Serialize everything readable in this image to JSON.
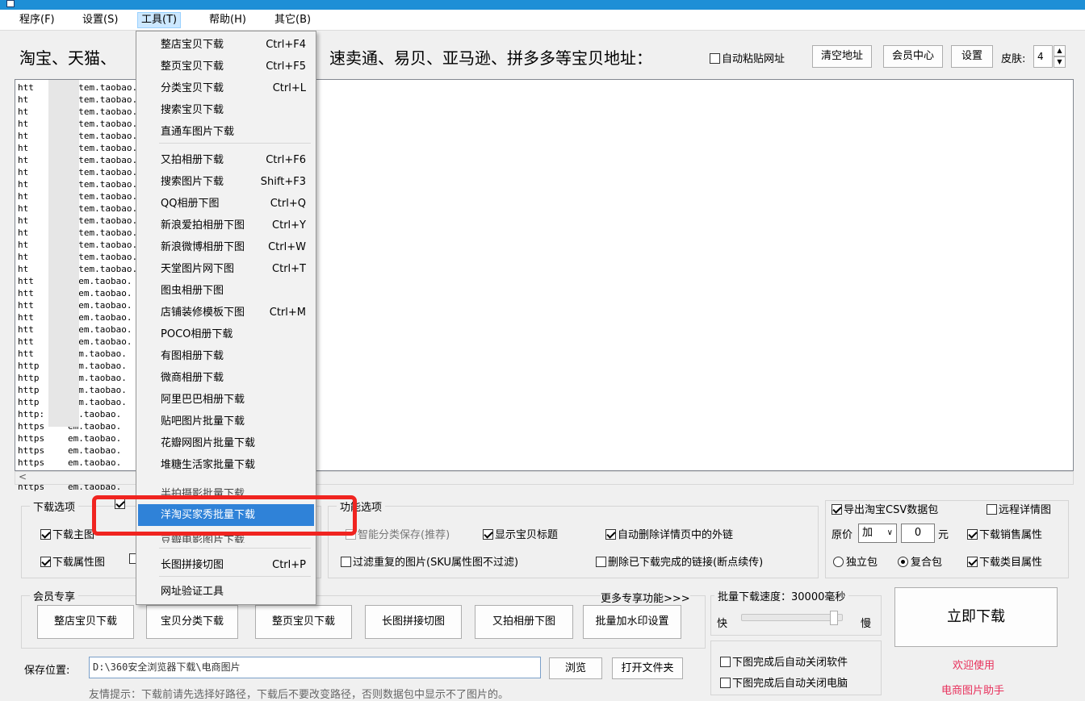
{
  "menubar": {
    "items": [
      {
        "label": "程序(F)"
      },
      {
        "label": "设置(S)"
      },
      {
        "label": "工具(T)"
      },
      {
        "label": "帮助(H)"
      },
      {
        "label": "其它(B)"
      }
    ]
  },
  "url_row": {
    "left_text": "淘宝、天猫、",
    "right_text": "速卖通、易贝、亚马逊、拼多多等宝贝地址：",
    "auto_paste_label": "自动粘贴网址",
    "clear_button": "清空地址",
    "member_button": "会员中心",
    "settings_button": "设置",
    "skin_label": "皮肤:",
    "skin_value": "4"
  },
  "url_list": {
    "rows": [
      {
        "prefix": "htt",
        "suffix": "/item.taobao."
      },
      {
        "prefix": "ht",
        "suffix": "/item.taobao."
      },
      {
        "prefix": "ht",
        "suffix": "/item.taobao."
      },
      {
        "prefix": "ht",
        "suffix": "/item.taobao."
      },
      {
        "prefix": "ht",
        "suffix": "/item.taobao."
      },
      {
        "prefix": "ht",
        "suffix": "/item.taobao."
      },
      {
        "prefix": "ht",
        "suffix": "/item.taobao."
      },
      {
        "prefix": "ht",
        "suffix": "/item.taobao."
      },
      {
        "prefix": "ht",
        "suffix": "/item.taobao."
      },
      {
        "prefix": "ht",
        "suffix": "/item.taobao."
      },
      {
        "prefix": "ht",
        "suffix": "/item.taobao."
      },
      {
        "prefix": "ht",
        "suffix": "/item.taobao."
      },
      {
        "prefix": "ht",
        "suffix": "/item.taobao."
      },
      {
        "prefix": "ht",
        "suffix": "/item.taobao."
      },
      {
        "prefix": "ht",
        "suffix": "/item.taobao."
      },
      {
        "prefix": "ht",
        "suffix": "/item.taobao."
      },
      {
        "prefix": "htt",
        "suffix": "item.taobao."
      },
      {
        "prefix": "htt",
        "suffix": "item.taobao."
      },
      {
        "prefix": "htt",
        "suffix": "item.taobao."
      },
      {
        "prefix": "htt",
        "suffix": "item.taobao."
      },
      {
        "prefix": "htt",
        "suffix": "item.taobao."
      },
      {
        "prefix": "htt",
        "suffix": "item.taobao."
      },
      {
        "prefix": "htt",
        "suffix": "tem.taobao."
      },
      {
        "prefix": "http",
        "suffix": "tem.taobao."
      },
      {
        "prefix": "http",
        "suffix": "tem.taobao."
      },
      {
        "prefix": "http",
        "suffix": "tem.taobao."
      },
      {
        "prefix": "http",
        "suffix": "tem.taobao."
      },
      {
        "prefix": "http:",
        "suffix": "em.taobao."
      },
      {
        "prefix": "https",
        "suffix": "em.taobao."
      },
      {
        "prefix": "https",
        "suffix": "em.taobao."
      },
      {
        "prefix": "https",
        "suffix": "em.taobao."
      },
      {
        "prefix": "https",
        "suffix": "em.taobao."
      },
      {
        "prefix": "https",
        "suffix": "em.taobao."
      },
      {
        "prefix": "https",
        "suffix": "em.taobao."
      }
    ]
  },
  "tools_menu": {
    "items": [
      {
        "label": "整店宝贝下载",
        "shortcut": "Ctrl+F4"
      },
      {
        "label": "整页宝贝下载",
        "shortcut": "Ctrl+F5"
      },
      {
        "label": "分类宝贝下载",
        "shortcut": "Ctrl+L"
      },
      {
        "label": "搜索宝贝下载",
        "shortcut": ""
      },
      {
        "label": "直通车图片下载",
        "shortcut": ""
      },
      {
        "label": "又拍相册下载",
        "shortcut": "Ctrl+F6"
      },
      {
        "label": "搜索图片下载",
        "shortcut": "Shift+F3"
      },
      {
        "label": "QQ相册下图",
        "shortcut": "Ctrl+Q"
      },
      {
        "label": "新浪爱拍相册下图",
        "shortcut": "Ctrl+Y"
      },
      {
        "label": "新浪微博相册下图",
        "shortcut": "Ctrl+W"
      },
      {
        "label": "天堂图片网下图",
        "shortcut": "Ctrl+T"
      },
      {
        "label": "图虫相册下图",
        "shortcut": ""
      },
      {
        "label": "店铺装修模板下图",
        "shortcut": "Ctrl+M"
      },
      {
        "label": "POCO相册下载",
        "shortcut": ""
      },
      {
        "label": "有图相册下载",
        "shortcut": ""
      },
      {
        "label": "微商相册下载",
        "shortcut": ""
      },
      {
        "label": "阿里巴巴相册下载",
        "shortcut": ""
      },
      {
        "label": "贴吧图片批量下载",
        "shortcut": ""
      },
      {
        "label": "花瓣网图片批量下载",
        "shortcut": ""
      },
      {
        "label": "堆糖生活家批量下载",
        "shortcut": ""
      },
      {
        "label": "洋淘买家秀批量下载",
        "shortcut": ""
      },
      {
        "label": "长图拼接切图",
        "shortcut": "Ctrl+P"
      },
      {
        "label": "网址验证工具",
        "shortcut": ""
      }
    ],
    "partial_1": "半拍摄影批量下载",
    "partial_2": "豆瓣电影图片下载"
  },
  "download_options": {
    "title": "下载选项",
    "main_image": "下载主图",
    "attr_image": "下载属性图"
  },
  "function_options": {
    "title": "功能选项",
    "smart_category": "智能分类保存(推荐)",
    "show_title": "显示宝贝标题",
    "auto_delete_links": "自动删除详情页中的外链",
    "filter_dup": "过滤重复的图片(SKU属性图不过滤)",
    "delete_done": "删除已下载完成的链接(断点续传)"
  },
  "export_options": {
    "export_csv": "导出淘宝CSV数据包",
    "remote_detail": "远程详情图",
    "price_label": "原价",
    "price_op": "加",
    "price_value": "0",
    "price_unit": "元",
    "sales_attr": "下载销售属性",
    "single_pkg": "独立包",
    "combo_pkg": "复合包",
    "category_attr": "下载类目属性"
  },
  "member": {
    "title": "会员专享",
    "more": "更多专享功能>>>",
    "buttons": [
      "整店宝贝下载",
      "宝贝分类下载",
      "整页宝贝下载",
      "长图拼接切图",
      "又拍相册下图",
      "批量加水印设置"
    ]
  },
  "speed": {
    "title": "批量下载速度：30000毫秒",
    "fast": "快",
    "slow": "慢",
    "level": 0.92,
    "close_app": "下图完成后自动关闭软件",
    "close_pc": "下图完成后自动关闭电脑"
  },
  "actions": {
    "download_now": "立即下载",
    "welcome": "欢迎使用",
    "app_name": "电商图片助手"
  },
  "save": {
    "label": "保存位置:",
    "path": "D:\\360安全浏览器下载\\电商图片",
    "browse": "浏览",
    "open_folder": "打开文件夹",
    "tip": "友情提示：下载前请先选择好路径，下载后不要改变路径，否则数据包中显示不了图片的。"
  },
  "colors": {
    "accent": "#2f82d8",
    "highlight_box": "#f02420",
    "brand_text": "#e8305b"
  }
}
